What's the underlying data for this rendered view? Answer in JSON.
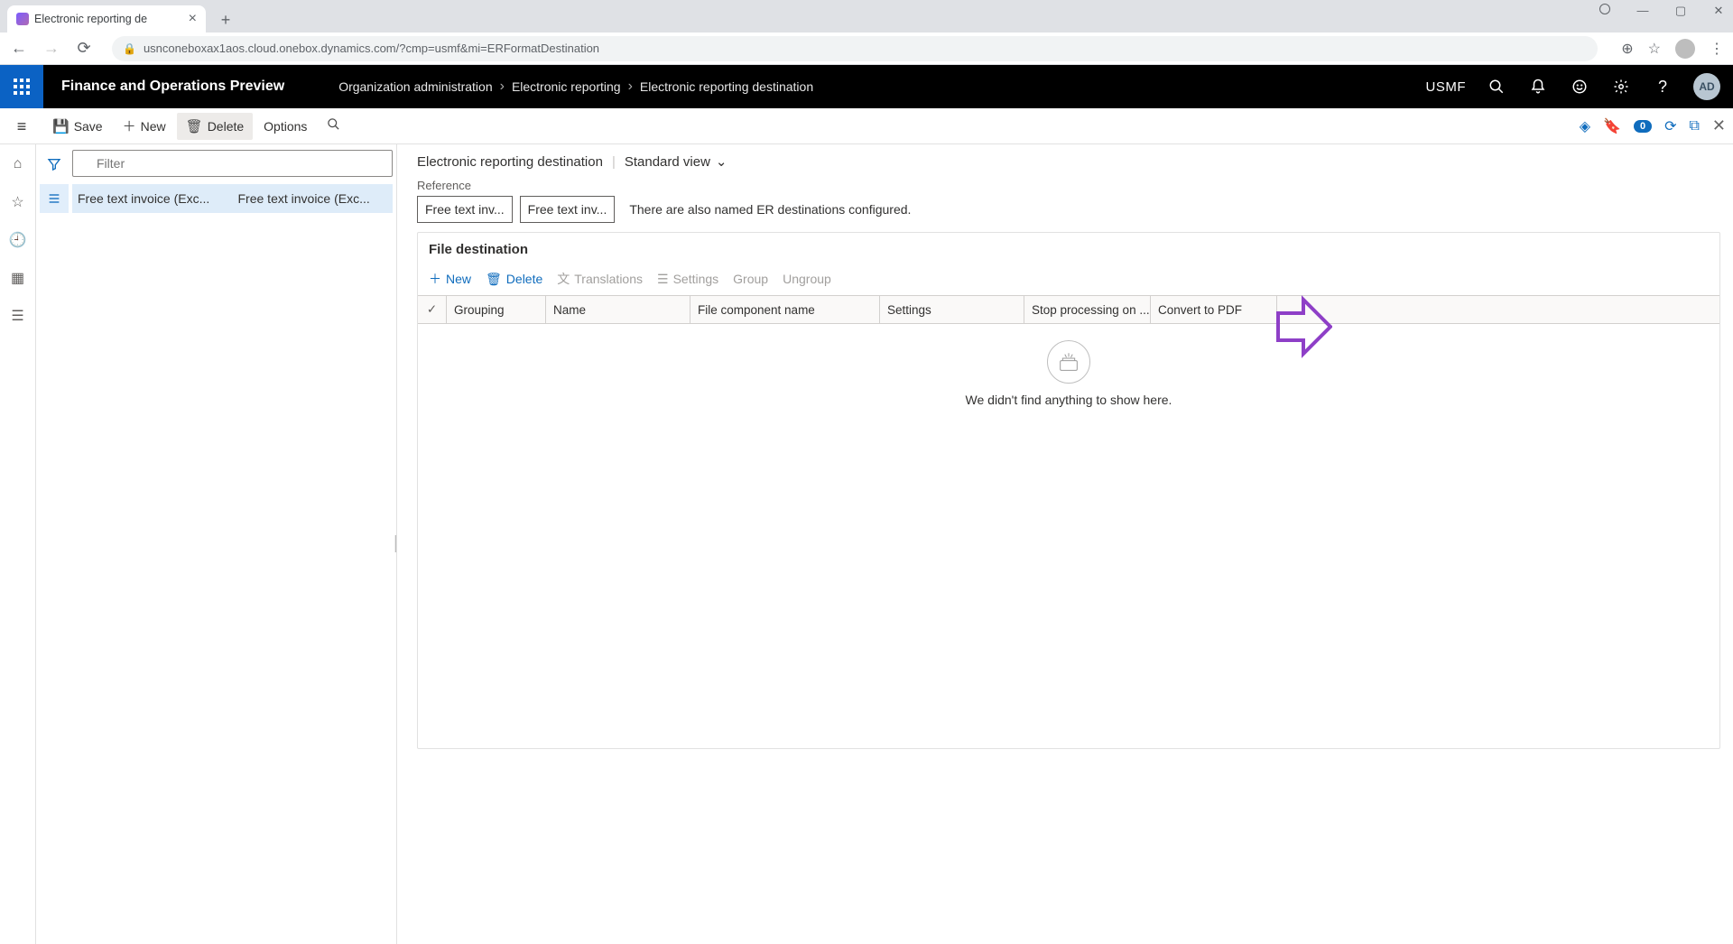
{
  "browser": {
    "tab_title": "Electronic reporting de",
    "url": "usnconeboxax1aos.cloud.onebox.dynamics.com/?cmp=usmf&mi=ERFormatDestination"
  },
  "app": {
    "title": "Finance and Operations Preview",
    "crumbs": [
      "Organization administration",
      "Electronic reporting",
      "Electronic reporting destination"
    ],
    "company": "USMF",
    "user_initials": "AD"
  },
  "actions": {
    "save": "Save",
    "new": "New",
    "delete": "Delete",
    "options": "Options",
    "badge": "0"
  },
  "list": {
    "filter_placeholder": "Filter",
    "row": {
      "col1": "Free text invoice (Exc...",
      "col2": "Free text invoice (Exc..."
    }
  },
  "detail": {
    "title": "Electronic reporting destination",
    "view": "Standard view",
    "ref_label": "Reference",
    "ref1": "Free text inv...",
    "ref2": "Free text inv...",
    "note": "There are also named ER destinations configured."
  },
  "file_dest": {
    "title": "File destination",
    "toolbar": {
      "new": "New",
      "delete": "Delete",
      "translations": "Translations",
      "settings": "Settings",
      "group": "Group",
      "ungroup": "Ungroup"
    },
    "columns": {
      "grouping": "Grouping",
      "name": "Name",
      "file_component": "File component name",
      "settings": "Settings",
      "stop": "Stop processing on ...",
      "pdf": "Convert to PDF"
    },
    "empty": "We didn't find anything to show here."
  }
}
